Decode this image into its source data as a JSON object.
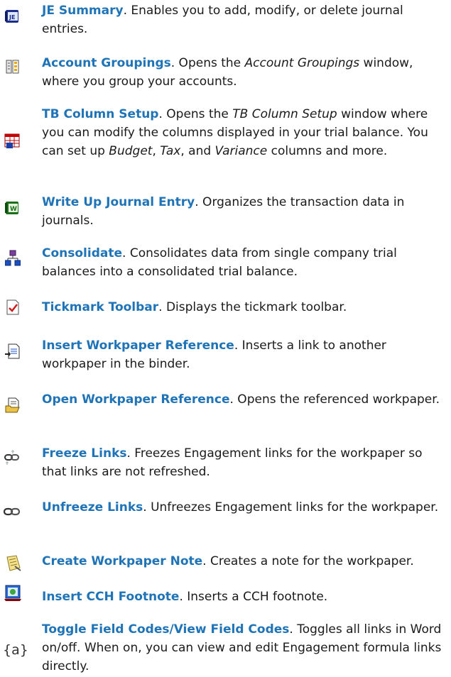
{
  "entries": [
    {
      "name": "JE Summary",
      "desc": ". Enables you to add, modify, or delete journal entries.",
      "icon": "je-summary-icon"
    },
    {
      "name": "Account Groupings",
      "desc_parts": [
        ". Opens the ",
        "Account Groupings",
        " window, where you group your accounts."
      ],
      "icon": "account-groupings-icon"
    },
    {
      "name": "TB Column Setup",
      "desc_parts": [
        ". Opens the ",
        "TB Column Setup",
        " window where you can modify the columns displayed in your trial balance. You can set up ",
        "Budget",
        ", ",
        "Tax",
        ", and ",
        "Variance",
        " columns and more."
      ],
      "icon": "tb-column-setup-icon"
    },
    {
      "name": "Write Up Journal Entry",
      "desc": ". Organizes the transaction data in journals.",
      "icon": "write-up-journal-entry-icon"
    },
    {
      "name": "Consolidate",
      "desc": ". Consolidates data from single company trial balances into a consolidated trial balance.",
      "icon": "consolidate-icon"
    },
    {
      "name": "Tickmark Toolbar",
      "desc": ". Displays the tickmark toolbar.",
      "icon": "tickmark-toolbar-icon"
    },
    {
      "name": "Insert Workpaper Reference",
      "desc": ". Inserts a link to another workpaper in the binder.",
      "icon": "insert-workpaper-reference-icon"
    },
    {
      "name": "Open Workpaper Reference",
      "desc": ". Opens the referenced workpaper.",
      "icon": "open-workpaper-reference-icon"
    },
    {
      "name": "Freeze Links",
      "desc": ". Freezes Engagement links for the workpaper so that links are not refreshed.",
      "icon": "freeze-links-icon"
    },
    {
      "name": "Unfreeze Links",
      "desc": ". Unfreezes Engagement links for the workpaper.",
      "icon": "unfreeze-links-icon"
    },
    {
      "name": "Create Workpaper Note",
      "desc": ". Creates a note for the workpaper.",
      "icon": "create-workpaper-note-icon"
    },
    {
      "name": "Insert CCH Footnote",
      "desc": ". Inserts a CCH footnote.",
      "icon": "insert-cch-footnote-icon"
    },
    {
      "name": "Toggle Field Codes/View Field Codes",
      "desc": ". Toggles all links in Word on/off. When on, you can view and edit Engagement formula links directly.",
      "icon": "toggle-field-codes-icon"
    }
  ],
  "colors": {
    "link": "#1f73b7",
    "text": "#1a1a1a"
  }
}
